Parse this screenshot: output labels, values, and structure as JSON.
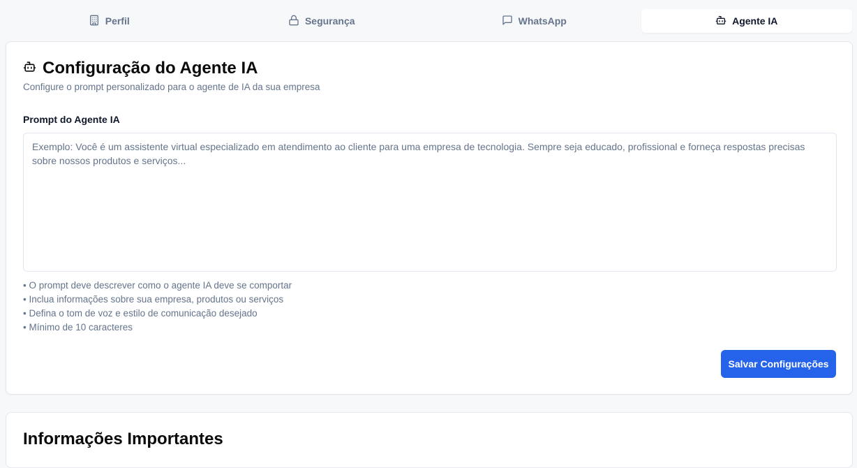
{
  "tabs": [
    {
      "label": "Perfil",
      "icon": "building-icon",
      "active": false
    },
    {
      "label": "Segurança",
      "icon": "lock-icon",
      "active": false
    },
    {
      "label": "WhatsApp",
      "icon": "message-square-icon",
      "active": false
    },
    {
      "label": "Agente IA",
      "icon": "bot-icon",
      "active": true
    }
  ],
  "agent_config": {
    "icon": "bot-icon",
    "title": "Configuração do Agente IA",
    "subtitle": "Configure o prompt personalizado para o agente de IA da sua empresa",
    "prompt_label": "Prompt do Agente IA",
    "prompt_value": "",
    "prompt_placeholder": "Exemplo: Você é um assistente virtual especializado em atendimento ao cliente para uma empresa de tecnologia. Sempre seja educado, profissional e forneça respostas precisas sobre nossos produtos e serviços...",
    "hints": [
      "O prompt deve descrever como o agente IA deve se comportar",
      "Inclua informações sobre sua empresa, produtos ou serviços",
      "Defina o tom de voz e estilo de comunicação desejado",
      "Mínimo de 10 caracteres"
    ],
    "save_label": "Salvar Configurações"
  },
  "important_info": {
    "title": "Informações Importantes"
  },
  "colors": {
    "accent": "#2563eb",
    "page_background": "#f6f8fa",
    "muted_text": "#64748b"
  }
}
